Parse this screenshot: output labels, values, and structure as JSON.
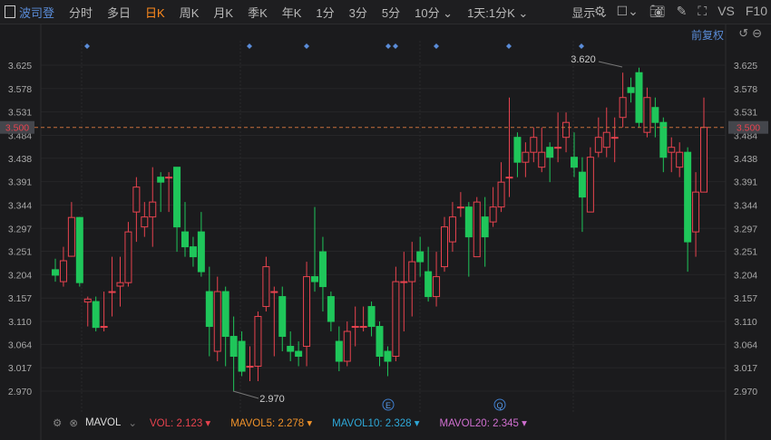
{
  "toolbar": {
    "stock": "波司登",
    "tabs": [
      "分时",
      "多日",
      "日K",
      "周K",
      "月K",
      "季K",
      "年K",
      "1分",
      "3分",
      "5分",
      "10分 ⌄",
      "1天:1分K ⌄"
    ],
    "selected": "日K",
    "display": "显示 ⌄",
    "vs": "VS",
    "f10": "F10"
  },
  "adjust": "前复权",
  "indicator": {
    "name": "MAVOL",
    "vol_label": "VOL:",
    "vol": "2.123 ▾",
    "m5_label": "MAVOL5:",
    "m5": "2.278 ▾",
    "m10_label": "MAVOL10:",
    "m10": "2.328 ▾",
    "m20_label": "MAVOL20:",
    "m20": "2.345 ▾"
  },
  "colors": {
    "up": "#e8434f",
    "down": "#1fc65a",
    "vol": "#e8434f",
    "m5": "#f0922a",
    "m10": "#2ea8d8",
    "m20": "#d06fd0",
    "accent": "#5a8cd8"
  },
  "chart_data": {
    "type": "candlestick",
    "y_ticks": [
      "3.625",
      "3.578",
      "3.531",
      "3.484",
      "3.438",
      "3.391",
      "3.344",
      "3.297",
      "3.251",
      "3.204",
      "3.157",
      "3.110",
      "3.064",
      "3.017",
      "2.970"
    ],
    "ylim": [
      2.97,
      3.625
    ],
    "last_price": "3.500",
    "high_label": "3.620",
    "low_label": "2.970",
    "event_markers": [
      "E",
      "Q"
    ],
    "ohlc": [
      [
        3.214,
        3.236,
        3.19,
        3.203
      ],
      [
        3.19,
        3.26,
        3.18,
        3.232
      ],
      [
        3.241,
        3.35,
        3.24,
        3.319
      ],
      [
        3.319,
        3.32,
        3.18,
        3.188
      ],
      [
        3.149,
        3.16,
        3.1,
        3.155
      ],
      [
        3.15,
        3.16,
        3.09,
        3.098
      ],
      [
        3.1,
        3.17,
        3.09,
        3.1
      ],
      [
        3.17,
        3.24,
        3.12,
        3.17
      ],
      [
        3.181,
        3.24,
        3.14,
        3.188
      ],
      [
        3.188,
        3.31,
        3.18,
        3.29
      ],
      [
        3.33,
        3.4,
        3.27,
        3.38
      ],
      [
        3.3,
        3.35,
        3.28,
        3.32
      ],
      [
        3.32,
        3.42,
        3.26,
        3.35
      ],
      [
        3.4,
        3.41,
        3.33,
        3.39
      ],
      [
        3.4,
        3.41,
        3.33,
        3.4
      ],
      [
        3.42,
        3.42,
        3.25,
        3.3
      ],
      [
        3.29,
        3.35,
        3.24,
        3.26
      ],
      [
        3.26,
        3.28,
        3.22,
        3.24
      ],
      [
        3.29,
        3.33,
        3.2,
        3.21
      ],
      [
        3.17,
        3.22,
        3.04,
        3.1
      ],
      [
        3.05,
        3.2,
        3.03,
        3.17
      ],
      [
        3.17,
        3.18,
        3.02,
        3.08
      ],
      [
        3.08,
        3.12,
        2.97,
        3.04
      ],
      [
        3.07,
        3.09,
        3.0,
        3.01
      ],
      [
        3.02,
        3.06,
        2.99,
        3.02
      ],
      [
        3.02,
        3.13,
        2.99,
        3.12
      ],
      [
        3.14,
        3.24,
        3.13,
        3.22
      ],
      [
        3.17,
        3.18,
        3.04,
        3.17
      ],
      [
        3.16,
        3.18,
        3.05,
        3.08
      ],
      [
        3.06,
        3.09,
        3.03,
        3.05
      ],
      [
        3.05,
        3.07,
        3.02,
        3.04
      ],
      [
        3.06,
        3.23,
        3.02,
        3.2
      ],
      [
        3.2,
        3.34,
        3.17,
        3.19
      ],
      [
        3.25,
        3.28,
        3.13,
        3.18
      ],
      [
        3.16,
        3.17,
        3.09,
        3.11
      ],
      [
        3.07,
        3.1,
        3.01,
        3.03
      ],
      [
        3.03,
        3.11,
        3.02,
        3.09
      ],
      [
        3.1,
        3.14,
        3.06,
        3.1
      ],
      [
        3.1,
        3.14,
        3.09,
        3.1
      ],
      [
        3.14,
        3.15,
        3.08,
        3.1
      ],
      [
        3.1,
        3.11,
        3.02,
        3.04
      ],
      [
        3.05,
        3.06,
        3.0,
        3.03
      ],
      [
        3.04,
        3.22,
        3.03,
        3.19
      ],
      [
        3.19,
        3.25,
        3.09,
        3.19
      ],
      [
        3.19,
        3.27,
        3.12,
        3.23
      ],
      [
        3.25,
        3.28,
        3.2,
        3.23
      ],
      [
        3.21,
        3.26,
        3.15,
        3.16
      ],
      [
        3.16,
        3.25,
        3.14,
        3.2
      ],
      [
        3.22,
        3.32,
        3.21,
        3.3
      ],
      [
        3.27,
        3.35,
        3.25,
        3.32
      ],
      [
        3.34,
        3.37,
        3.32,
        3.34
      ],
      [
        3.34,
        3.35,
        3.2,
        3.28
      ],
      [
        3.24,
        3.36,
        3.24,
        3.35
      ],
      [
        3.32,
        3.36,
        3.22,
        3.28
      ],
      [
        3.31,
        3.38,
        3.3,
        3.34
      ],
      [
        3.34,
        3.43,
        3.33,
        3.39
      ],
      [
        3.4,
        3.56,
        3.36,
        3.4
      ],
      [
        3.48,
        3.49,
        3.4,
        3.43
      ],
      [
        3.43,
        3.47,
        3.4,
        3.45
      ],
      [
        3.45,
        3.5,
        3.43,
        3.48
      ],
      [
        3.42,
        3.5,
        3.41,
        3.45
      ],
      [
        3.46,
        3.47,
        3.39,
        3.44
      ],
      [
        3.46,
        3.53,
        3.43,
        3.46
      ],
      [
        3.48,
        3.53,
        3.45,
        3.51
      ],
      [
        3.44,
        3.49,
        3.4,
        3.42
      ],
      [
        3.41,
        3.44,
        3.29,
        3.36
      ],
      [
        3.33,
        3.46,
        3.33,
        3.44
      ],
      [
        3.45,
        3.52,
        3.44,
        3.48
      ],
      [
        3.46,
        3.54,
        3.44,
        3.49
      ],
      [
        3.48,
        3.52,
        3.43,
        3.48
      ],
      [
        3.52,
        3.61,
        3.5,
        3.56
      ],
      [
        3.58,
        3.6,
        3.55,
        3.57
      ],
      [
        3.61,
        3.62,
        3.5,
        3.51
      ],
      [
        3.49,
        3.58,
        3.48,
        3.56
      ],
      [
        3.54,
        3.56,
        3.48,
        3.51
      ],
      [
        3.51,
        3.52,
        3.41,
        3.44
      ],
      [
        3.45,
        3.48,
        3.41,
        3.46
      ],
      [
        3.42,
        3.47,
        3.4,
        3.45
      ],
      [
        3.45,
        3.46,
        3.21,
        3.27
      ],
      [
        3.29,
        3.41,
        3.24,
        3.37
      ],
      [
        3.37,
        3.56,
        3.37,
        3.5
      ]
    ]
  }
}
